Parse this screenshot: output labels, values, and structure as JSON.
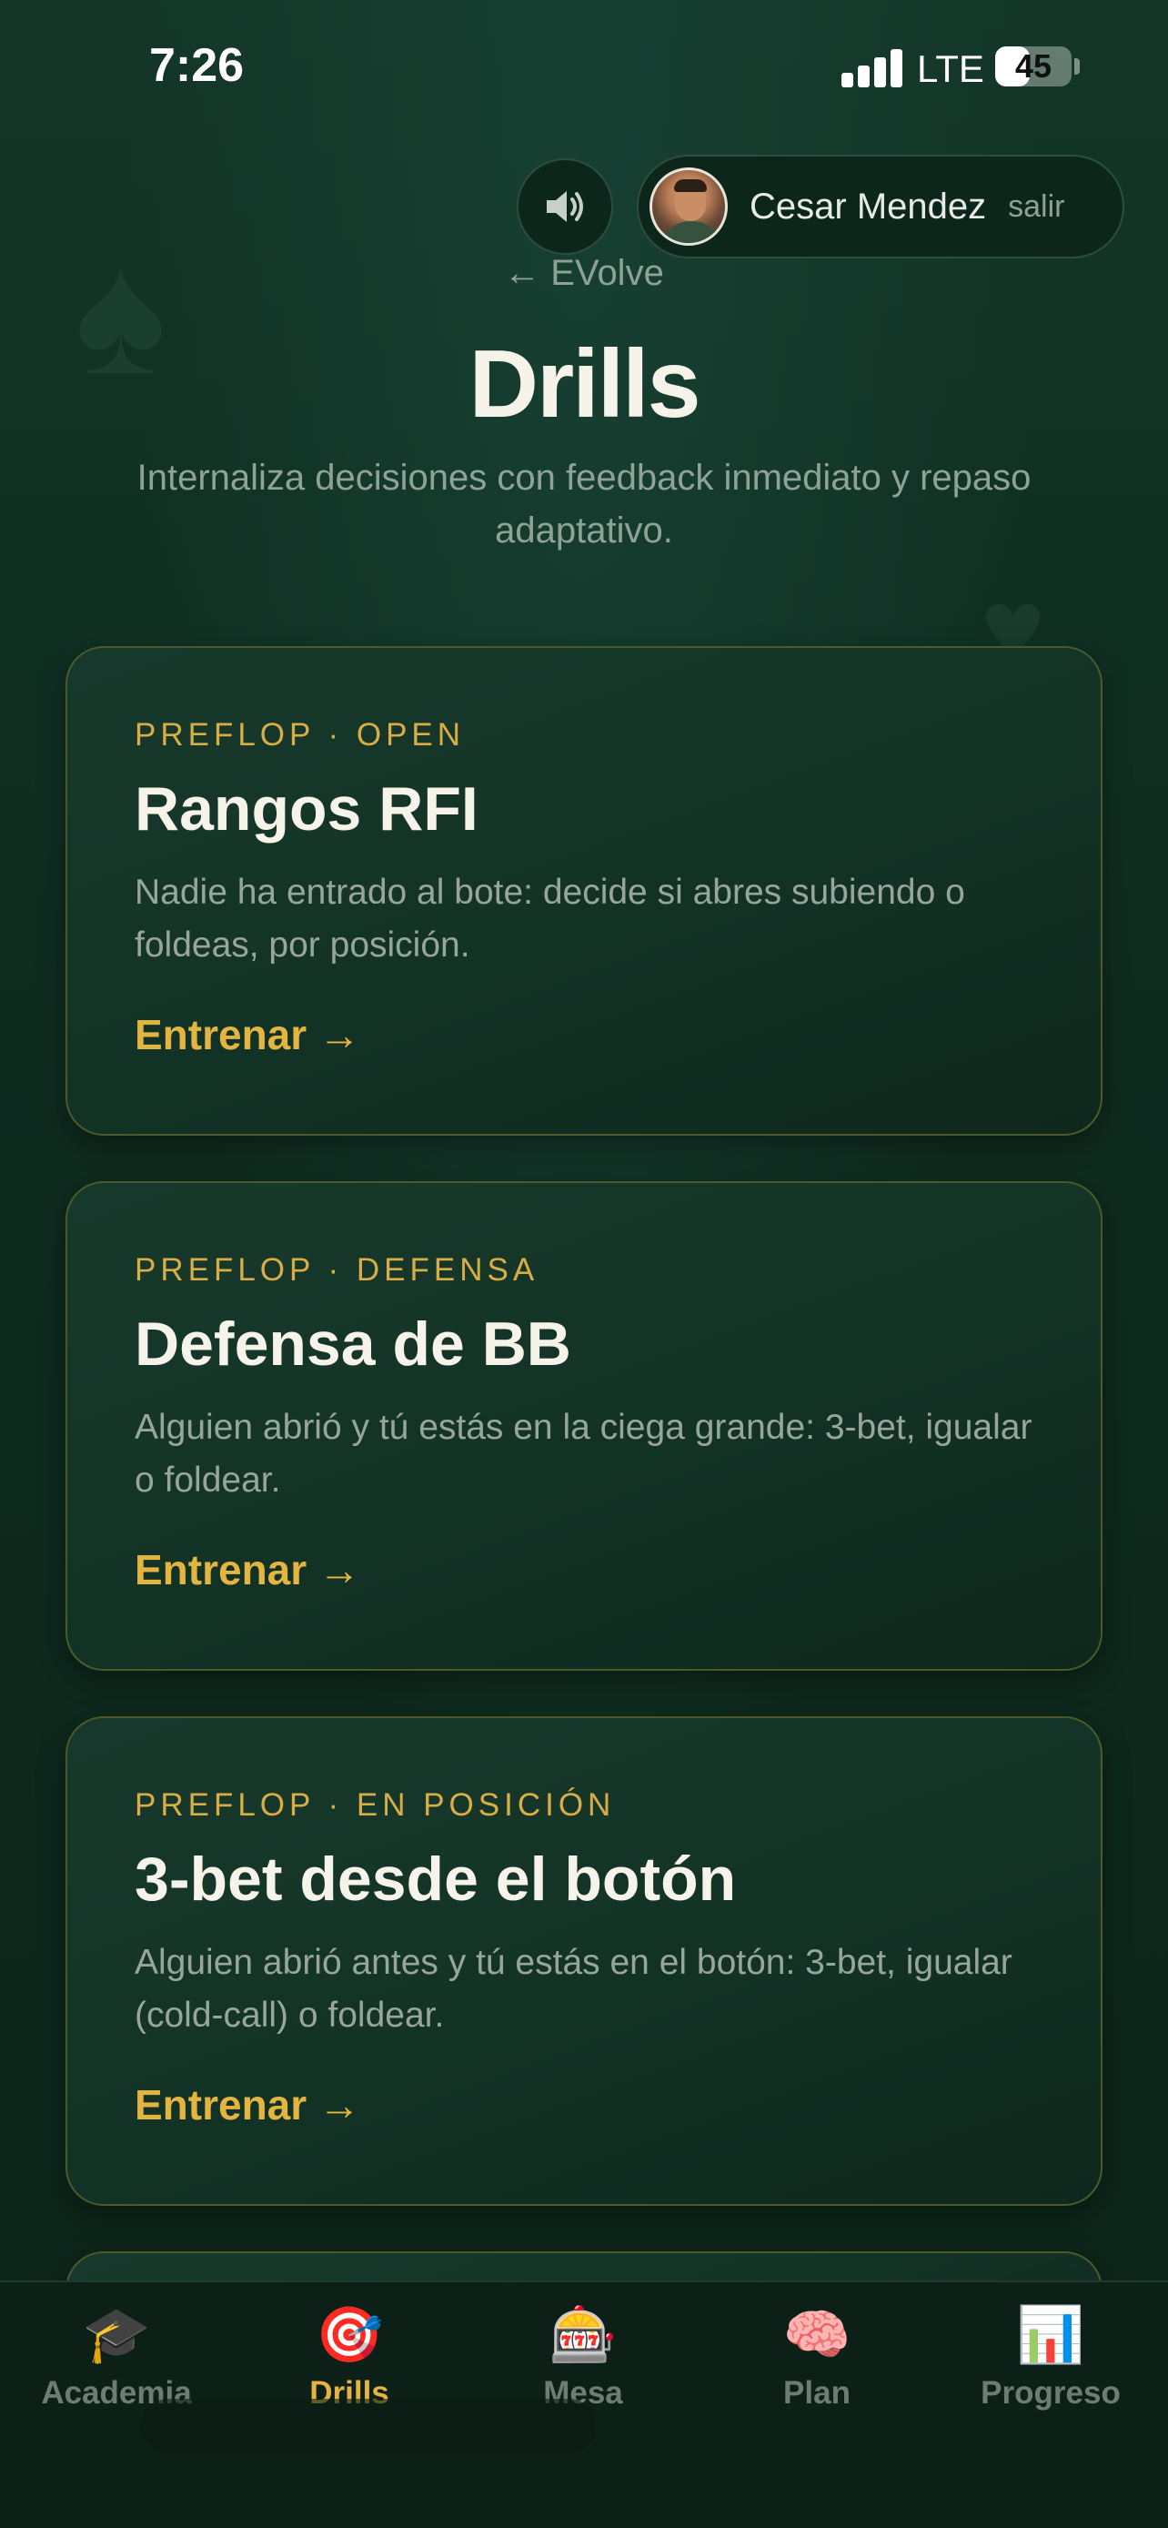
{
  "status_bar": {
    "time": "7:26",
    "network": "LTE",
    "battery": "45",
    "battery_level": 0.45
  },
  "header": {
    "sound_icon": "speaker-icon",
    "user_name": "Cesar Mendez",
    "logout_label": "salir",
    "back_link": "← EVolve"
  },
  "page": {
    "title": "Drills",
    "subtitle": "Internaliza decisiones con feedback inmediato y repaso adaptativo."
  },
  "cards": [
    {
      "tag": "PREFLOP · OPEN",
      "title": "Rangos RFI",
      "description": "Nadie ha entrado al bote: decide si abres subiendo o foldeas, por posición.",
      "cta": "Entrenar →"
    },
    {
      "tag": "PREFLOP · DEFENSA",
      "title": "Defensa de BB",
      "description": "Alguien abrió y tú estás en la ciega grande: 3-bet, igualar o foldear.",
      "cta": "Entrenar →"
    },
    {
      "tag": "PREFLOP · EN POSICIÓN",
      "title": "3-bet desde el botón",
      "description": "Alguien abrió antes y tú estás en el botón: 3-bet, igualar (cold-call) o foldear.",
      "cta": "Entrenar →"
    }
  ],
  "bottom_nav": {
    "items": [
      {
        "label": "Academia",
        "icon": "graduation-cap-icon",
        "glyph": "🎓"
      },
      {
        "label": "Drills",
        "icon": "target-icon",
        "glyph": "🎯",
        "active": true
      },
      {
        "label": "Mesa",
        "icon": "slot-machine-icon",
        "glyph": "🎰"
      },
      {
        "label": "Plan",
        "icon": "brain-icon",
        "glyph": "🧠"
      },
      {
        "label": "Progreso",
        "icon": "bar-chart-icon",
        "glyph": "📊"
      }
    ]
  },
  "colors": {
    "background": "#0f2a1f",
    "accent_gold": "#e3b440",
    "tag_gold": "#d9ad45",
    "text_primary": "#f6f3ea",
    "text_muted": "#8fa298"
  }
}
